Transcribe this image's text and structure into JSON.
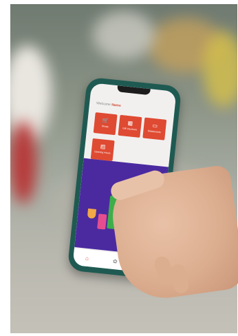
{
  "app": {
    "welcome_prefix": "Welcome",
    "welcome_name": "Name",
    "tiles": [
      {
        "label": "Shops",
        "icon": "cart-icon"
      },
      {
        "label": "Gift Vouchers",
        "icon": "gift-icon"
      },
      {
        "label": "Restaurants",
        "icon": "restaurant-icon"
      },
      {
        "label": "Opening Hours",
        "icon": "calendar-icon"
      }
    ],
    "nav": [
      {
        "icon": "home-icon",
        "glyph": "⌂",
        "active": true
      },
      {
        "icon": "settings-icon",
        "glyph": "✿",
        "active": false
      },
      {
        "icon": "mail-icon",
        "glyph": "✉",
        "active": false
      }
    ],
    "accent_color": "#df4a32",
    "banner_color": "#4b2aa0",
    "phone_case_color": "#1f5a52"
  }
}
